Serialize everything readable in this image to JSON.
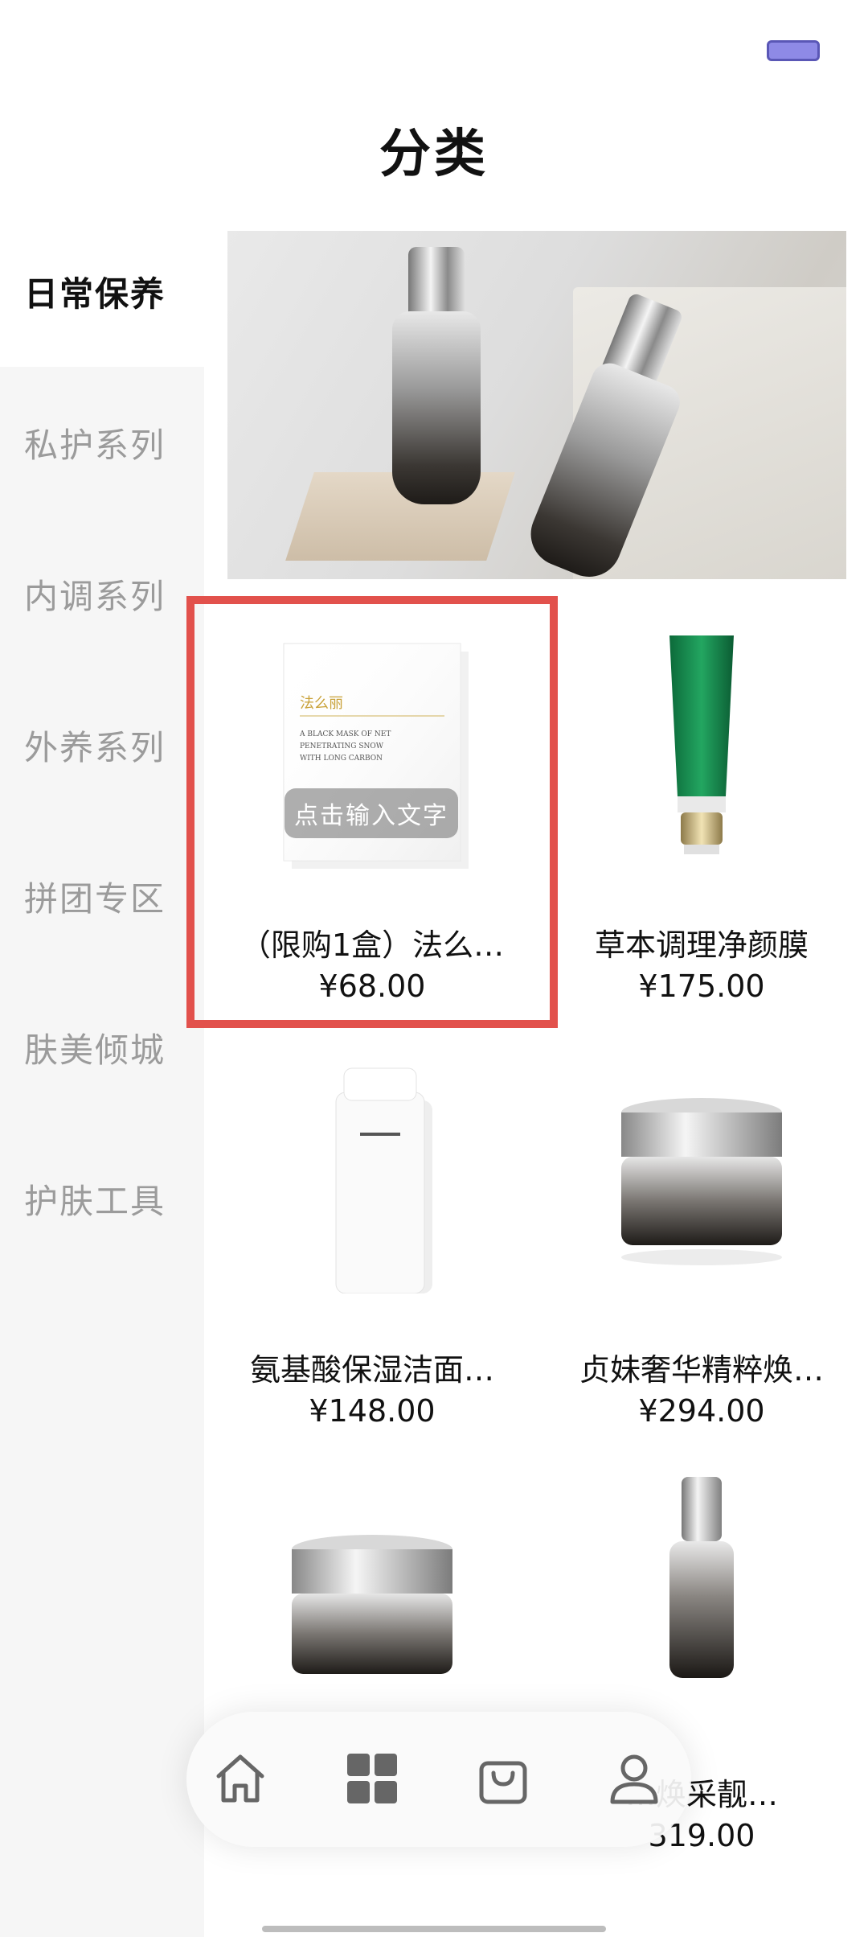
{
  "header": {
    "title": "分类"
  },
  "sidebar": {
    "items": [
      {
        "label": "日常保养",
        "active": true
      },
      {
        "label": "私护系列",
        "active": false
      },
      {
        "label": "内调系列",
        "active": false
      },
      {
        "label": "外养系列",
        "active": false
      },
      {
        "label": "拼团专区",
        "active": false
      },
      {
        "label": "肤美倾城",
        "active": false
      },
      {
        "label": "护肤工具",
        "active": false
      }
    ]
  },
  "products": [
    {
      "name": "（限购1盒）法么…",
      "price": "¥68.00",
      "tooltip": "点击输入文字",
      "box_text": "法么丽",
      "box_sub": "A BLACK MASK OF NET PENETRATING SNOW WITH LONG CARBON"
    },
    {
      "name": "草本调理净颜膜",
      "price": "¥175.00"
    },
    {
      "name": "氨基酸保湿洁面…",
      "price": "¥148.00"
    },
    {
      "name": "贞妹奢华精粹焕…",
      "price": "¥294.00"
    },
    {
      "name": "",
      "price": ""
    },
    {
      "name": "…焕采靓…",
      "price": "319.00"
    }
  ],
  "tabbar": {
    "items": [
      {
        "icon": "home-icon"
      },
      {
        "icon": "grid-icon"
      },
      {
        "icon": "bag-icon"
      },
      {
        "icon": "user-icon"
      }
    ]
  },
  "colors": {
    "highlight": "#e2514c",
    "active_text": "#111111",
    "inactive_text": "#9b9b9b"
  }
}
